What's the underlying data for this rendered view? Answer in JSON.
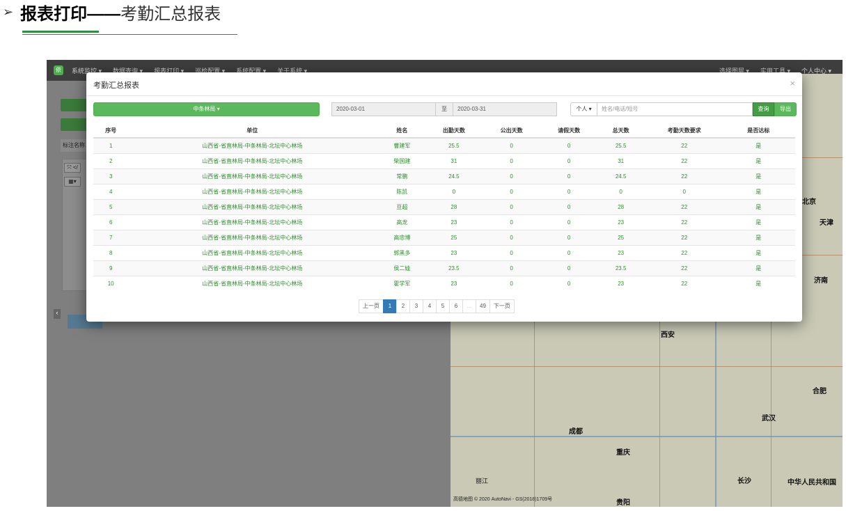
{
  "heading": {
    "arrow": "➢",
    "bold": "报表打印——",
    "light": "考勤汇总报表"
  },
  "navbar": {
    "logo": "依",
    "left_items": [
      "系统监控 ▾",
      "数据查询 ▾",
      "报表打印 ▾",
      "巡检配置 ▾",
      "系统配置 ▾",
      "关于系统 ▾"
    ],
    "right_items": [
      "选择图层 ▾",
      "实用工具 ▾",
      "个人中心 ▾"
    ]
  },
  "left_panel": {
    "input_label": "标注名称",
    "tool1": "⤧ </",
    "tool2": "▦▾",
    "caret": "‹"
  },
  "map": {
    "labels": [
      "北京",
      "天津",
      "济南",
      "西安",
      "合肥",
      "武汉",
      "成都",
      "重庆",
      "长沙",
      "贵阳",
      "丽江",
      "中华人民共和国"
    ],
    "copyright": "高德地图 © 2020 AutoNavi - GS(2018)1709号"
  },
  "modal": {
    "title": "考勤汇总报表",
    "close": "×",
    "org_button": "中条林局 ▾",
    "date_from": "2020-03-01",
    "date_sep": "至",
    "date_to": "2020-03-31",
    "person_button": "个人 ▾",
    "search_placeholder": "姓名/电话/短号",
    "query_button": "查询",
    "export_button": "导出"
  },
  "table": {
    "headers": [
      "序号",
      "单位",
      "姓名",
      "出勤天数",
      "公出天数",
      "请假天数",
      "总天数",
      "考勤天数要求",
      "是否达标"
    ],
    "rows": [
      [
        "1",
        "山西省-省直林局-中条林局-北坛中心林场",
        "曹建军",
        "25.5",
        "0",
        "0",
        "25.5",
        "22",
        "是"
      ],
      [
        "2",
        "山西省-省直林局-中条林局-北坛中心林场",
        "柴国建",
        "31",
        "0",
        "0",
        "31",
        "22",
        "是"
      ],
      [
        "3",
        "山西省-省直林局-中条林局-北坛中心林场",
        "常鹏",
        "24.5",
        "0",
        "0",
        "24.5",
        "22",
        "是"
      ],
      [
        "4",
        "山西省-省直林局-中条林局-北坛中心林场",
        "陈凯",
        "0",
        "0",
        "0",
        "0",
        "0",
        "是"
      ],
      [
        "5",
        "山西省-省直林局-中条林局-北坛中心林场",
        "豆超",
        "28",
        "0",
        "0",
        "28",
        "22",
        "是"
      ],
      [
        "6",
        "山西省-省直林局-中条林局-北坛中心林场",
        "高龙",
        "23",
        "0",
        "0",
        "23",
        "22",
        "是"
      ],
      [
        "7",
        "山西省-省直林局-中条林局-北坛中心林场",
        "高忠博",
        "25",
        "0",
        "0",
        "25",
        "22",
        "是"
      ],
      [
        "8",
        "山西省-省直林局-中条林局-北坛中心林场",
        "郭黑多",
        "23",
        "0",
        "0",
        "23",
        "22",
        "是"
      ],
      [
        "9",
        "山西省-省直林局-中条林局-北坛中心林场",
        "侯二娃",
        "23.5",
        "0",
        "0",
        "23.5",
        "22",
        "是"
      ],
      [
        "10",
        "山西省-省直林局-中条林局-北坛中心林场",
        "霍学军",
        "23",
        "0",
        "0",
        "23",
        "22",
        "是"
      ]
    ]
  },
  "pagination": {
    "prev": "上一页",
    "pages": [
      "1",
      "2",
      "3",
      "4",
      "5",
      "6"
    ],
    "ellipsis": "...",
    "last": "49",
    "next": "下一页"
  }
}
